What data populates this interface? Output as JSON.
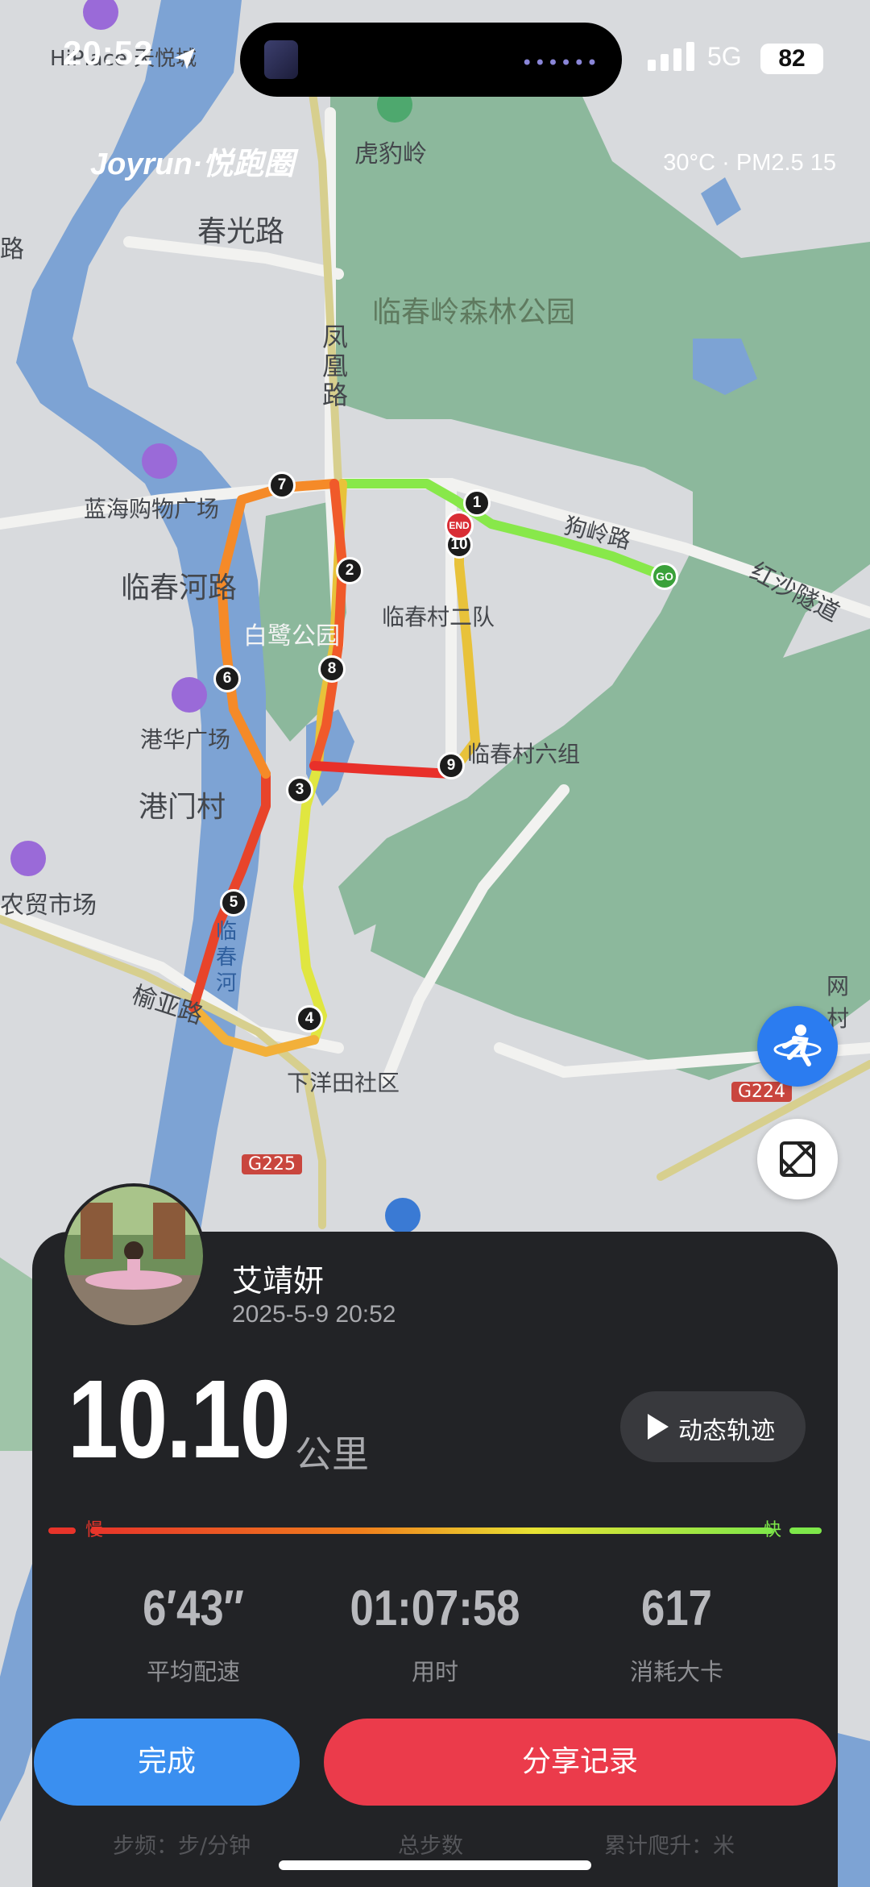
{
  "status_bar": {
    "time": "20:52",
    "network": "5G",
    "battery": "82"
  },
  "app": {
    "brand": "Joyrun·悦跑圈",
    "weather": "30°C · PM2.5 15"
  },
  "map_labels": {
    "hotel": "HiPlace 天悦城",
    "chunguang_rd": "春光路",
    "hubaoling": "虎豹岭",
    "forest_park": "临春岭森林公园",
    "fenghuang_rd": "凤凰路",
    "lanhai": "蓝海购物广场",
    "linchunhe_rd": "临春河路",
    "bailu_park": "白鹭公园",
    "village_2": "临春村二队",
    "ganghua": "港华广场",
    "gangmen": "港门村",
    "village_6": "临春村六组",
    "market": "农贸市场",
    "river": "临春河",
    "yuya_rd": "榆亚路",
    "xiayangtian": "下洋田社区",
    "g224": "G224",
    "g225": "G225",
    "hongsha": "红沙隧道",
    "baoling_rd": "狗岭路",
    "wangcun": "网村",
    "lu": "路"
  },
  "route_markers": [
    "1",
    "2",
    "3",
    "4",
    "5",
    "6",
    "7",
    "8",
    "9",
    "10"
  ],
  "route_start": "GO",
  "route_end": "END",
  "user": {
    "name": "艾靖妍",
    "datetime": "2025-5-9 20:52"
  },
  "run": {
    "distance": "10.10",
    "distance_unit": "公里",
    "replay_label": "动态轨迹",
    "pace_slow": "慢",
    "pace_fast": "快"
  },
  "stats": [
    {
      "value": "6′43″",
      "label": "平均配速"
    },
    {
      "value": "01:07:58",
      "label": "用时"
    },
    {
      "value": "617",
      "label": "消耗大卡"
    }
  ],
  "buttons": {
    "done": "完成",
    "share": "分享记录"
  },
  "extra_stats": [
    "步频：步/分钟",
    "总步数",
    "累计爬升：米"
  ],
  "colors": {
    "done": "#3a8ff0",
    "share": "#eb3b4b",
    "card": "#222326"
  }
}
